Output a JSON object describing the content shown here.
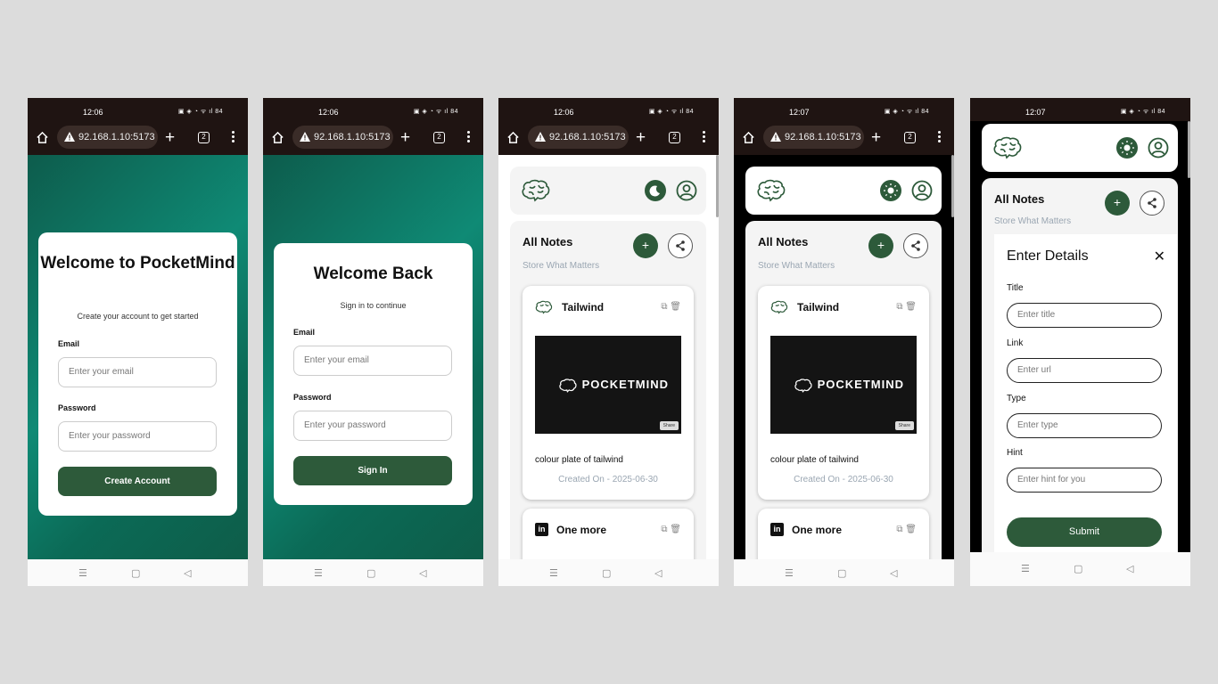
{
  "status": {
    "p1": {
      "time": "12:06"
    },
    "p2": {
      "time": "12:06"
    },
    "p3": {
      "time": "12:06"
    },
    "p4": {
      "time": "12:07"
    },
    "p5": {
      "time": "12:07"
    },
    "battery": "84"
  },
  "browser": {
    "url": "92.168.1.10:5173",
    "tab_count": "2"
  },
  "signup": {
    "title": "Welcome to PocketMind",
    "subtitle": "Create your account to get started",
    "email_label": "Email",
    "email_placeholder": "Enter your email",
    "password_label": "Password",
    "password_placeholder": "Enter your password",
    "button": "Create Account"
  },
  "signin": {
    "title": "Welcome Back",
    "subtitle": "Sign in to continue",
    "email_label": "Email",
    "email_placeholder": "Enter your email",
    "password_label": "Password",
    "password_placeholder": "Enter your password",
    "button": "Sign In"
  },
  "notes": {
    "heading": "All Notes",
    "tagline": "Store What Matters",
    "add_label": "+",
    "cards": [
      {
        "title": "Tailwind",
        "thumb_brand": "POCKETMIND",
        "thumb_share": "Share",
        "description": "colour plate of tailwind",
        "date": "Created On - 2025-06-30"
      },
      {
        "title": "One more",
        "icon_text": "in"
      }
    ]
  },
  "modal": {
    "title": "Enter Details",
    "close": "✕",
    "fields": [
      {
        "label": "Title",
        "placeholder": "Enter title"
      },
      {
        "label": "Link",
        "placeholder": "Enter url"
      },
      {
        "label": "Type",
        "placeholder": "Enter type"
      },
      {
        "label": "Hint",
        "placeholder": "Enter hint for you"
      }
    ],
    "submit": "Submit"
  },
  "colors": {
    "accent": "#2d5a3a",
    "teal": "#0f8a75",
    "statusbar": "#1f1412"
  }
}
